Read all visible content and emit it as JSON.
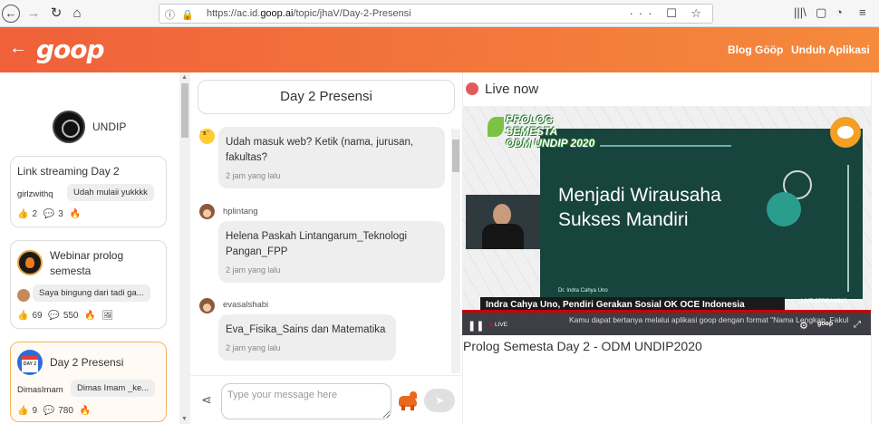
{
  "browser": {
    "url_prefix": "https://ac.id.",
    "url_domain": "goop.ai",
    "url_path": "/topic/jhaV/Day-2-Presensi",
    "actions": "··· ☐ ☆",
    "library_icon": "|||\\",
    "sidebar_icon": "▢",
    "ext_icon": "◔",
    "menu_icon": "≡"
  },
  "header": {
    "logo": "goop",
    "links": [
      "Blog Gööp",
      "Unduh Aplikasi"
    ],
    "back_icon": "arrow-left-icon"
  },
  "sidebar": {
    "org_name": "UNDIP",
    "cards": [
      {
        "title": "Link streaming Day 2",
        "user": "girlzwithq",
        "message": "Udah mulaii yukkkk",
        "likes": "2",
        "comments": "3",
        "has_icon": false
      },
      {
        "title": "Webinar prolog semesta",
        "message": "Saya bingung dari tadi ga...",
        "likes": "69",
        "comments": "550"
      },
      {
        "title": "Day 2 Presensi",
        "user": "DimasImam",
        "message": "Dimas Imam _ke...",
        "likes": "9",
        "comments": "780",
        "active": true
      }
    ]
  },
  "chat": {
    "title": "Day 2 Presensi",
    "messages": [
      {
        "user": "",
        "text": "Udah masuk web? Ketik (nama, jurusan, fakultas?",
        "time": "2 jam yang lalu"
      },
      {
        "user": "hplintang",
        "text": "Helena Paskah Lintangarum_Teknologi Pangan_FPP",
        "time": "2 jam yang lalu"
      },
      {
        "user": "evasalshabi",
        "text": "Eva_Fisika_Sains dan Matematika",
        "time": "2 jam yang lalu"
      }
    ],
    "input_placeholder": "Type your message here",
    "send_icon": "➤"
  },
  "live": {
    "label": "Live now",
    "video_title": "Prolog Semesta Day 2 - ODM UNDIP2020",
    "slide_title_line1": "Menjadi Wirausaha",
    "slide_title_line2": "Sukses Mandiri",
    "presenter": "Dr. Indra Cahya Uno",
    "lower_third": "Indra Cahya Uno, Pendiri Gerakan Sosial OK OCE Indonesia",
    "ticker": "Kamu dapat bertanya melalui aplikasi goop dengan format \"Nama Lengkap_Fakul",
    "live_tag": "LIVE",
    "live_streaming": "LIVE STREAMING",
    "prolog_line1": "PROLOG SEMESTA",
    "prolog_line2": "ODM UNDIP 2020",
    "yt_badge": "goop"
  }
}
